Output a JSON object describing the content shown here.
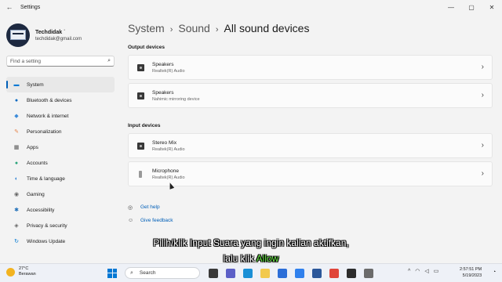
{
  "window": {
    "title": "Settings",
    "back_icon": "←",
    "controls": [
      "—",
      "▢",
      "✕"
    ]
  },
  "profile": {
    "name": "Techdidak ˙",
    "email": "techdidak@gmail.com"
  },
  "search": {
    "placeholder": "Find a setting"
  },
  "sidebar": {
    "items": [
      {
        "label": "System",
        "icon": "monitor-icon",
        "glyph": "▬",
        "color": "#0078d4",
        "active": true
      },
      {
        "label": "Bluetooth & devices",
        "icon": "bluetooth-icon",
        "glyph": "●",
        "color": "#0067c0"
      },
      {
        "label": "Network & internet",
        "icon": "wifi-icon",
        "glyph": "◆",
        "color": "#3c8bd9"
      },
      {
        "label": "Personalization",
        "icon": "brush-icon",
        "glyph": "✎",
        "color": "#e6844a"
      },
      {
        "label": "Apps",
        "icon": "apps-icon",
        "glyph": "▦",
        "color": "#555555"
      },
      {
        "label": "Accounts",
        "icon": "person-icon",
        "glyph": "●",
        "color": "#2aa37a"
      },
      {
        "label": "Time & language",
        "icon": "globe-icon",
        "glyph": "◐",
        "color": "#2a7fd4"
      },
      {
        "label": "Gaming",
        "icon": "gamepad-icon",
        "glyph": "◉",
        "color": "#666666"
      },
      {
        "label": "Accessibility",
        "icon": "accessibility-icon",
        "glyph": "✱",
        "color": "#1f6fb8"
      },
      {
        "label": "Privacy & security",
        "icon": "shield-icon",
        "glyph": "◈",
        "color": "#666666"
      },
      {
        "label": "Windows Update",
        "icon": "update-icon",
        "glyph": "↻",
        "color": "#0078d4"
      }
    ]
  },
  "breadcrumb": {
    "part1": "System",
    "part2": "Sound",
    "current": "All sound devices",
    "separator": "›"
  },
  "output": {
    "heading": "Output devices",
    "devices": [
      {
        "name": "Speakers",
        "sub": "Realtek(R) Audio"
      },
      {
        "name": "Speakers",
        "sub": "Nahimic mirroring device"
      }
    ]
  },
  "input": {
    "heading": "Input devices",
    "devices": [
      {
        "name": "Stereo Mix",
        "sub": "Realtek(R) Audio"
      },
      {
        "name": "Microphone",
        "sub": "Realtek(R) Audio"
      }
    ]
  },
  "links": {
    "help": "Get help",
    "feedback": "Give feedback"
  },
  "subtitle": {
    "line1": "Pilih/klik Input Suara yang ingin kalian aktifkan,",
    "line2_prefix": "lalu klik ",
    "line2_highlight": "Allow",
    "highlight_color": "#6cf04a"
  },
  "taskbar": {
    "temp": "27°C",
    "weather": "Berawan",
    "search_label": "Search",
    "time": "2:57:51 PM",
    "date": "5/19/2023",
    "tray_chevron": "^",
    "apps": [
      {
        "icon": "taskview-icon",
        "color": "#3a3a3a"
      },
      {
        "icon": "teams-icon",
        "color": "#5b5fc7"
      },
      {
        "icon": "edge-icon",
        "color": "#1a8fd6"
      },
      {
        "icon": "explorer-icon",
        "color": "#f2c94c"
      },
      {
        "icon": "store-icon",
        "color": "#2b6ed8"
      },
      {
        "icon": "pen-icon",
        "color": "#2f80ed"
      },
      {
        "icon": "word-icon",
        "color": "#2b579a"
      },
      {
        "icon": "chrome-icon",
        "color": "#e0453a"
      },
      {
        "icon": "terminal-icon",
        "color": "#2c2c2c"
      },
      {
        "icon": "settings-icon",
        "color": "#6b6b6b"
      }
    ]
  }
}
